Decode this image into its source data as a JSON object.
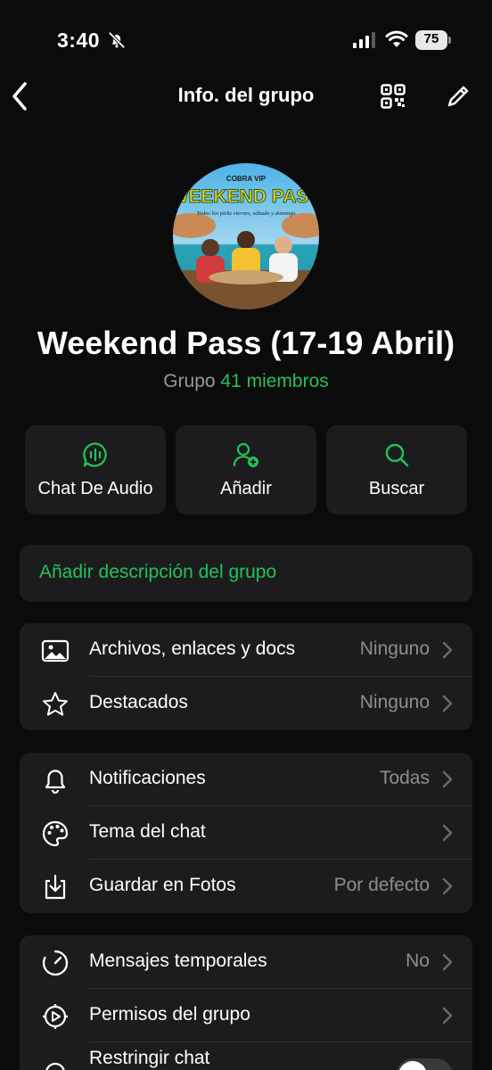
{
  "status_bar": {
    "time": "3:40",
    "battery": "75",
    "icons": [
      "bell-slash-icon",
      "signal-icon",
      "wifi-icon",
      "battery-icon"
    ]
  },
  "nav": {
    "title": "Info. del grupo",
    "icons": [
      "back-icon",
      "qr-code-icon",
      "edit-icon"
    ]
  },
  "group": {
    "avatar_text_top": "COBRA VIP",
    "avatar_text_main": "WEEKEND PASS",
    "avatar_text_tag": "Todos los picks viernes, sábado y domingo",
    "name": "Weekend Pass (17-19 Abril)",
    "subtitle_label": "Grupo",
    "members": "41 miembros"
  },
  "actions": [
    {
      "label": "Chat De Audio",
      "icon": "audio-chat-icon"
    },
    {
      "label": "Añadir",
      "icon": "add-person-icon"
    },
    {
      "label": "Buscar",
      "icon": "search-icon"
    }
  ],
  "description_prompt": "Añadir descripción del grupo",
  "media_section": [
    {
      "label": "Archivos, enlaces y docs",
      "value": "Ninguno",
      "icon": "image-icon"
    },
    {
      "label": "Destacados",
      "value": "Ninguno",
      "icon": "star-icon"
    }
  ],
  "settings_section": [
    {
      "label": "Notificaciones",
      "value": "Todas",
      "icon": "bell-icon"
    },
    {
      "label": "Tema del chat",
      "value": "",
      "icon": "palette-icon"
    },
    {
      "label": "Guardar en Fotos",
      "value": "Por defecto",
      "icon": "download-icon"
    }
  ],
  "privacy_section": [
    {
      "label": "Mensajes temporales",
      "value": "No",
      "icon": "timer-icon"
    },
    {
      "label": "Permisos del grupo",
      "value": "",
      "icon": "gear-icon"
    },
    {
      "label": "Restringir chat",
      "value": "",
      "icon": "lock-chat-icon",
      "toggle": false
    }
  ],
  "colors": {
    "accent": "#25c05a",
    "background": "#0b0b0b",
    "card": "#1c1c1e",
    "secondary_text": "#8e8e8e"
  }
}
